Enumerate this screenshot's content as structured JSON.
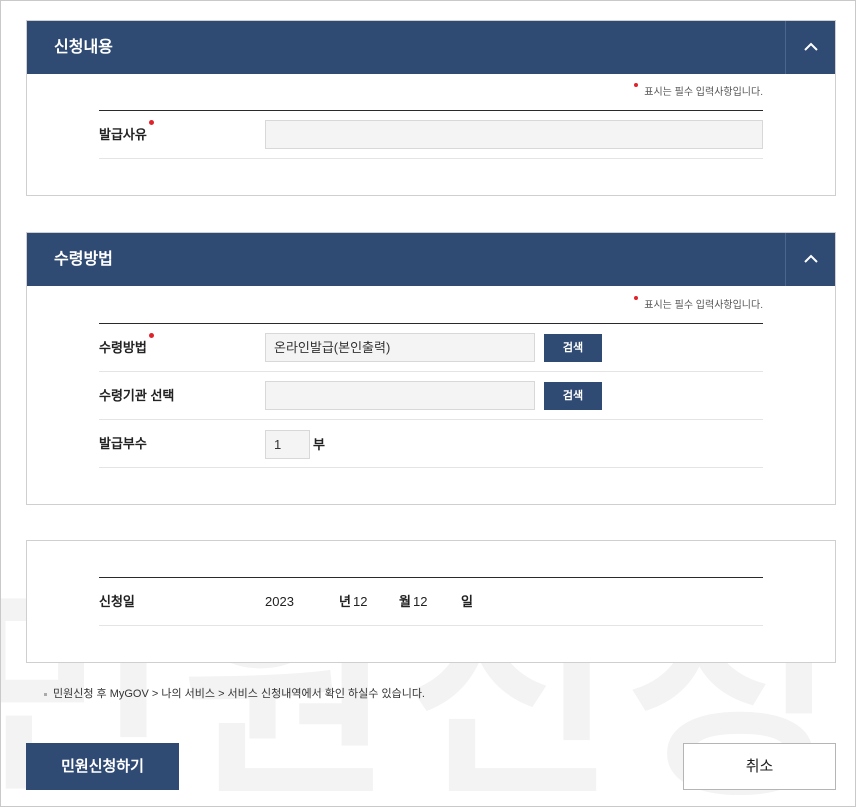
{
  "watermark": {
    "text": "민원신청"
  },
  "section1": {
    "title": "신청내용",
    "required_note": "표시는 필수 입력사항입니다.",
    "fields": {
      "reason": {
        "label": "발급사유",
        "value": ""
      }
    }
  },
  "section2": {
    "title": "수령방법",
    "required_note": "표시는 필수 입력사항입니다.",
    "fields": {
      "method": {
        "label": "수령방법",
        "value": "온라인발급(본인출력)",
        "button": "검색"
      },
      "agency": {
        "label": "수령기관 선택",
        "value": "",
        "button": "검색"
      },
      "copies": {
        "label": "발급부수",
        "value": "1",
        "unit": "부"
      }
    }
  },
  "section3": {
    "date": {
      "label": "신청일",
      "year": "2023",
      "year_unit": "년",
      "month": "12",
      "month_unit": "월",
      "day": "12",
      "day_unit": "일"
    }
  },
  "notice": "민원신청 후 MyGOV > 나의 서비스 > 서비스 신청내역에서 확인 하실수 있습니다.",
  "actions": {
    "submit": "민원신청하기",
    "cancel": "취소"
  },
  "colors": {
    "header_bg": "#2f4a73",
    "required_dot": "#e0232b"
  },
  "icons": {
    "collapse": "chevron-up-icon"
  }
}
